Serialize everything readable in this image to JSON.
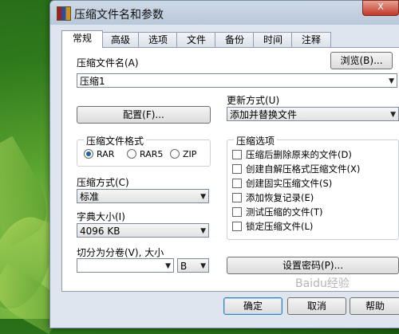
{
  "window": {
    "title": "压缩文件名和参数",
    "close_label": "X"
  },
  "tabs": [
    "常规",
    "高级",
    "选项",
    "文件",
    "备份",
    "时间",
    "注释"
  ],
  "general": {
    "archive_name_label": "压缩文件名(A)",
    "browse_button": "浏览(B)...",
    "archive_name_value": "压缩1",
    "update_mode_label": "更新方式(U)",
    "update_mode_value": "添加并替换文件",
    "profiles_button": "配置(F)...",
    "format_group_title": "压缩文件格式",
    "formats": [
      "RAR",
      "RAR5",
      "ZIP"
    ],
    "selected_format": "RAR",
    "method_label": "压缩方式(C)",
    "method_value": "标准",
    "dict_label": "字典大小(I)",
    "dict_value": "4096 KB",
    "split_label": "切分为分卷(V), 大小",
    "split_value": "",
    "split_unit": "B",
    "options_group_title": "压缩选项",
    "options": [
      "压缩后删除原来的文件(D)",
      "创建自解压格式压缩文件(X)",
      "创建固实压缩文件(S)",
      "添加恢复记录(E)",
      "测试压缩的文件(T)",
      "锁定压缩文件(L)"
    ],
    "password_button": "设置密码(P)..."
  },
  "footer": {
    "ok": "确定",
    "cancel": "取消",
    "help": "帮助"
  },
  "watermark": "Baidu经验"
}
